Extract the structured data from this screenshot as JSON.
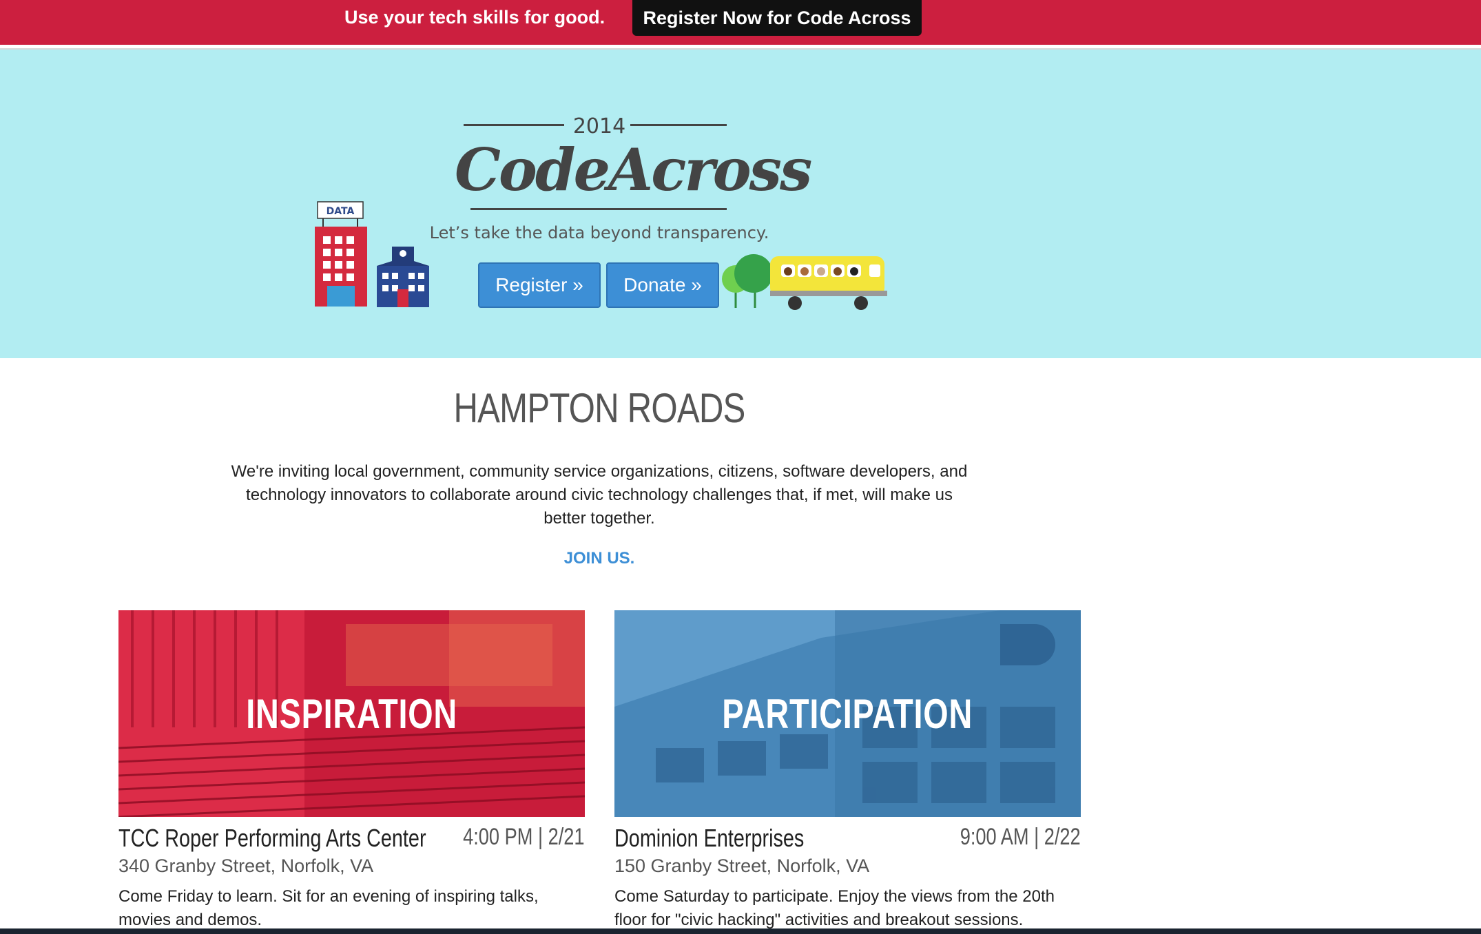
{
  "banner": {
    "tagline": "Use your tech skills for good.",
    "cta": "Register Now for Code Across",
    "background": "#cc1f3f"
  },
  "hero": {
    "year": "2014",
    "logo": "CodeAcross",
    "tagline": "Let’s take the data beyond transparency.",
    "register_label": "Register »",
    "donate_label": "Donate »",
    "building_sign": "DATA",
    "background": "#b2edf2",
    "button_color": "#3d8fd6",
    "icons": [
      "city-hall-building-icon",
      "school-building-icon",
      "trees-icon",
      "school-bus-icon"
    ]
  },
  "intro": {
    "region": "HAMPTON ROADS",
    "text": "We're inviting local government, community service organizations, citizens, software developers, and technology innovators to collaborate around civic technology challenges that, if met, will make us better together.",
    "join_label": "JOIN US."
  },
  "events": [
    {
      "title": "INSPIRATION",
      "venue": "TCC Roper Performing Arts Center",
      "time": "4:00 PM | 2/21",
      "address": "340 Granby Street, Norfolk, VA",
      "description": "Come Friday to learn. Sit for an evening of inspiring talks, movies and demos.",
      "tint": "#cc1f3f"
    },
    {
      "title": "PARTICIPATION",
      "venue": "Dominion Enterprises",
      "time": "9:00 AM | 2/22",
      "address": "150 Granby Street, Norfolk, VA",
      "description": "Come Saturday to participate. Enjoy the views from the 20th floor for \"civic hacking\" activities and breakout sessions.",
      "tint": "#4a8fc0"
    }
  ]
}
